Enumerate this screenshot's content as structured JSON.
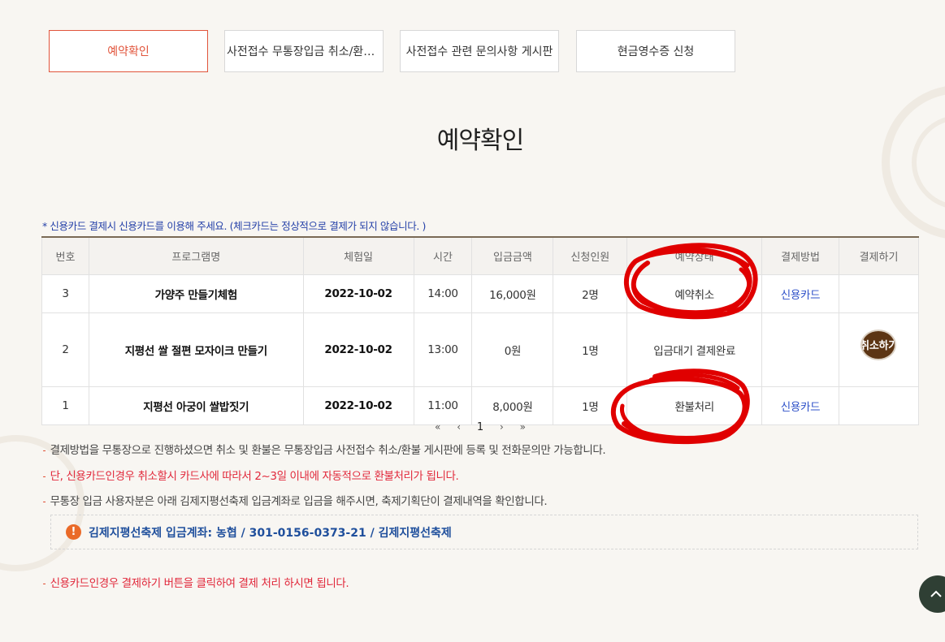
{
  "tabs": [
    {
      "label": "예약확인",
      "active": true
    },
    {
      "label": "사전접수 무통장입금 취소/환불 게시판",
      "active": false
    },
    {
      "label": "사전접수 관련 문의사항 게시판",
      "active": false
    },
    {
      "label": "현금영수증 신청",
      "active": false
    }
  ],
  "page_title": "예약확인",
  "notice_top": "* 신용카드 결제시 신용카드를 이용해 주세요. (체크카드는 정상적으로 결제가 되지 않습니다. )",
  "table": {
    "headers": [
      "번호",
      "프로그램명",
      "체험일",
      "시간",
      "입금금액",
      "신청인원",
      "예약상태",
      "결제방법",
      "결제하기"
    ],
    "rows": [
      {
        "no": "3",
        "program": "가양주 만들기체험",
        "date": "2022-10-02",
        "time": "14:00",
        "amount": "16,000원",
        "people": "2명",
        "status": "예약취소",
        "pay_method": "신용카드",
        "pay_action": ""
      },
      {
        "no": "2",
        "program": "지평선 쌀 절편 모자이크 만들기",
        "date": "2022-10-02",
        "time": "13:00",
        "amount": "0원",
        "people": "1명",
        "status": "입금대기 결제완료",
        "pay_method": "",
        "pay_action": "취소하기"
      },
      {
        "no": "1",
        "program": "지평선 아궁이 쌀밥짓기",
        "date": "2022-10-02",
        "time": "11:00",
        "amount": "8,000원",
        "people": "1명",
        "status": "환불처리",
        "pay_method": "신용카드",
        "pay_action": ""
      }
    ]
  },
  "pagination": {
    "first": "«",
    "prev": "‹",
    "current": "1",
    "next": "›",
    "last": "»"
  },
  "notes": [
    "결제방법을 무통장으로 진행하셨으면 취소 및 환불은 무통장입금 사전접수 취소/환불 게시판에 등록 및 전화문의만 가능합니다.",
    "단, 신용카드인경우 취소할시 카드사에 따라서 2~3일 이내에 자동적으로 환불처리가 됩니다.",
    "무통장 입금 사용자분은 아래 김제지평선축제 입금계좌로 입금을 해주시면, 축제기획단이 결제내역을 확인합니다."
  ],
  "account_info": "김제지평선축제 입금계좌: 농협 / 301-0156-0373-21 / 김제지평선축제",
  "note_bottom": "신용카드인경우 결제하기 버튼을 클릭하여 결제 처리 하시면 됩니다.",
  "icons": {
    "warning": "!",
    "bullet": "⁃",
    "scroll_top": "^"
  },
  "colors": {
    "accent": "#e1543b",
    "link": "#2d50c8",
    "account": "#1f4f9c",
    "annotation": "#e00000"
  }
}
